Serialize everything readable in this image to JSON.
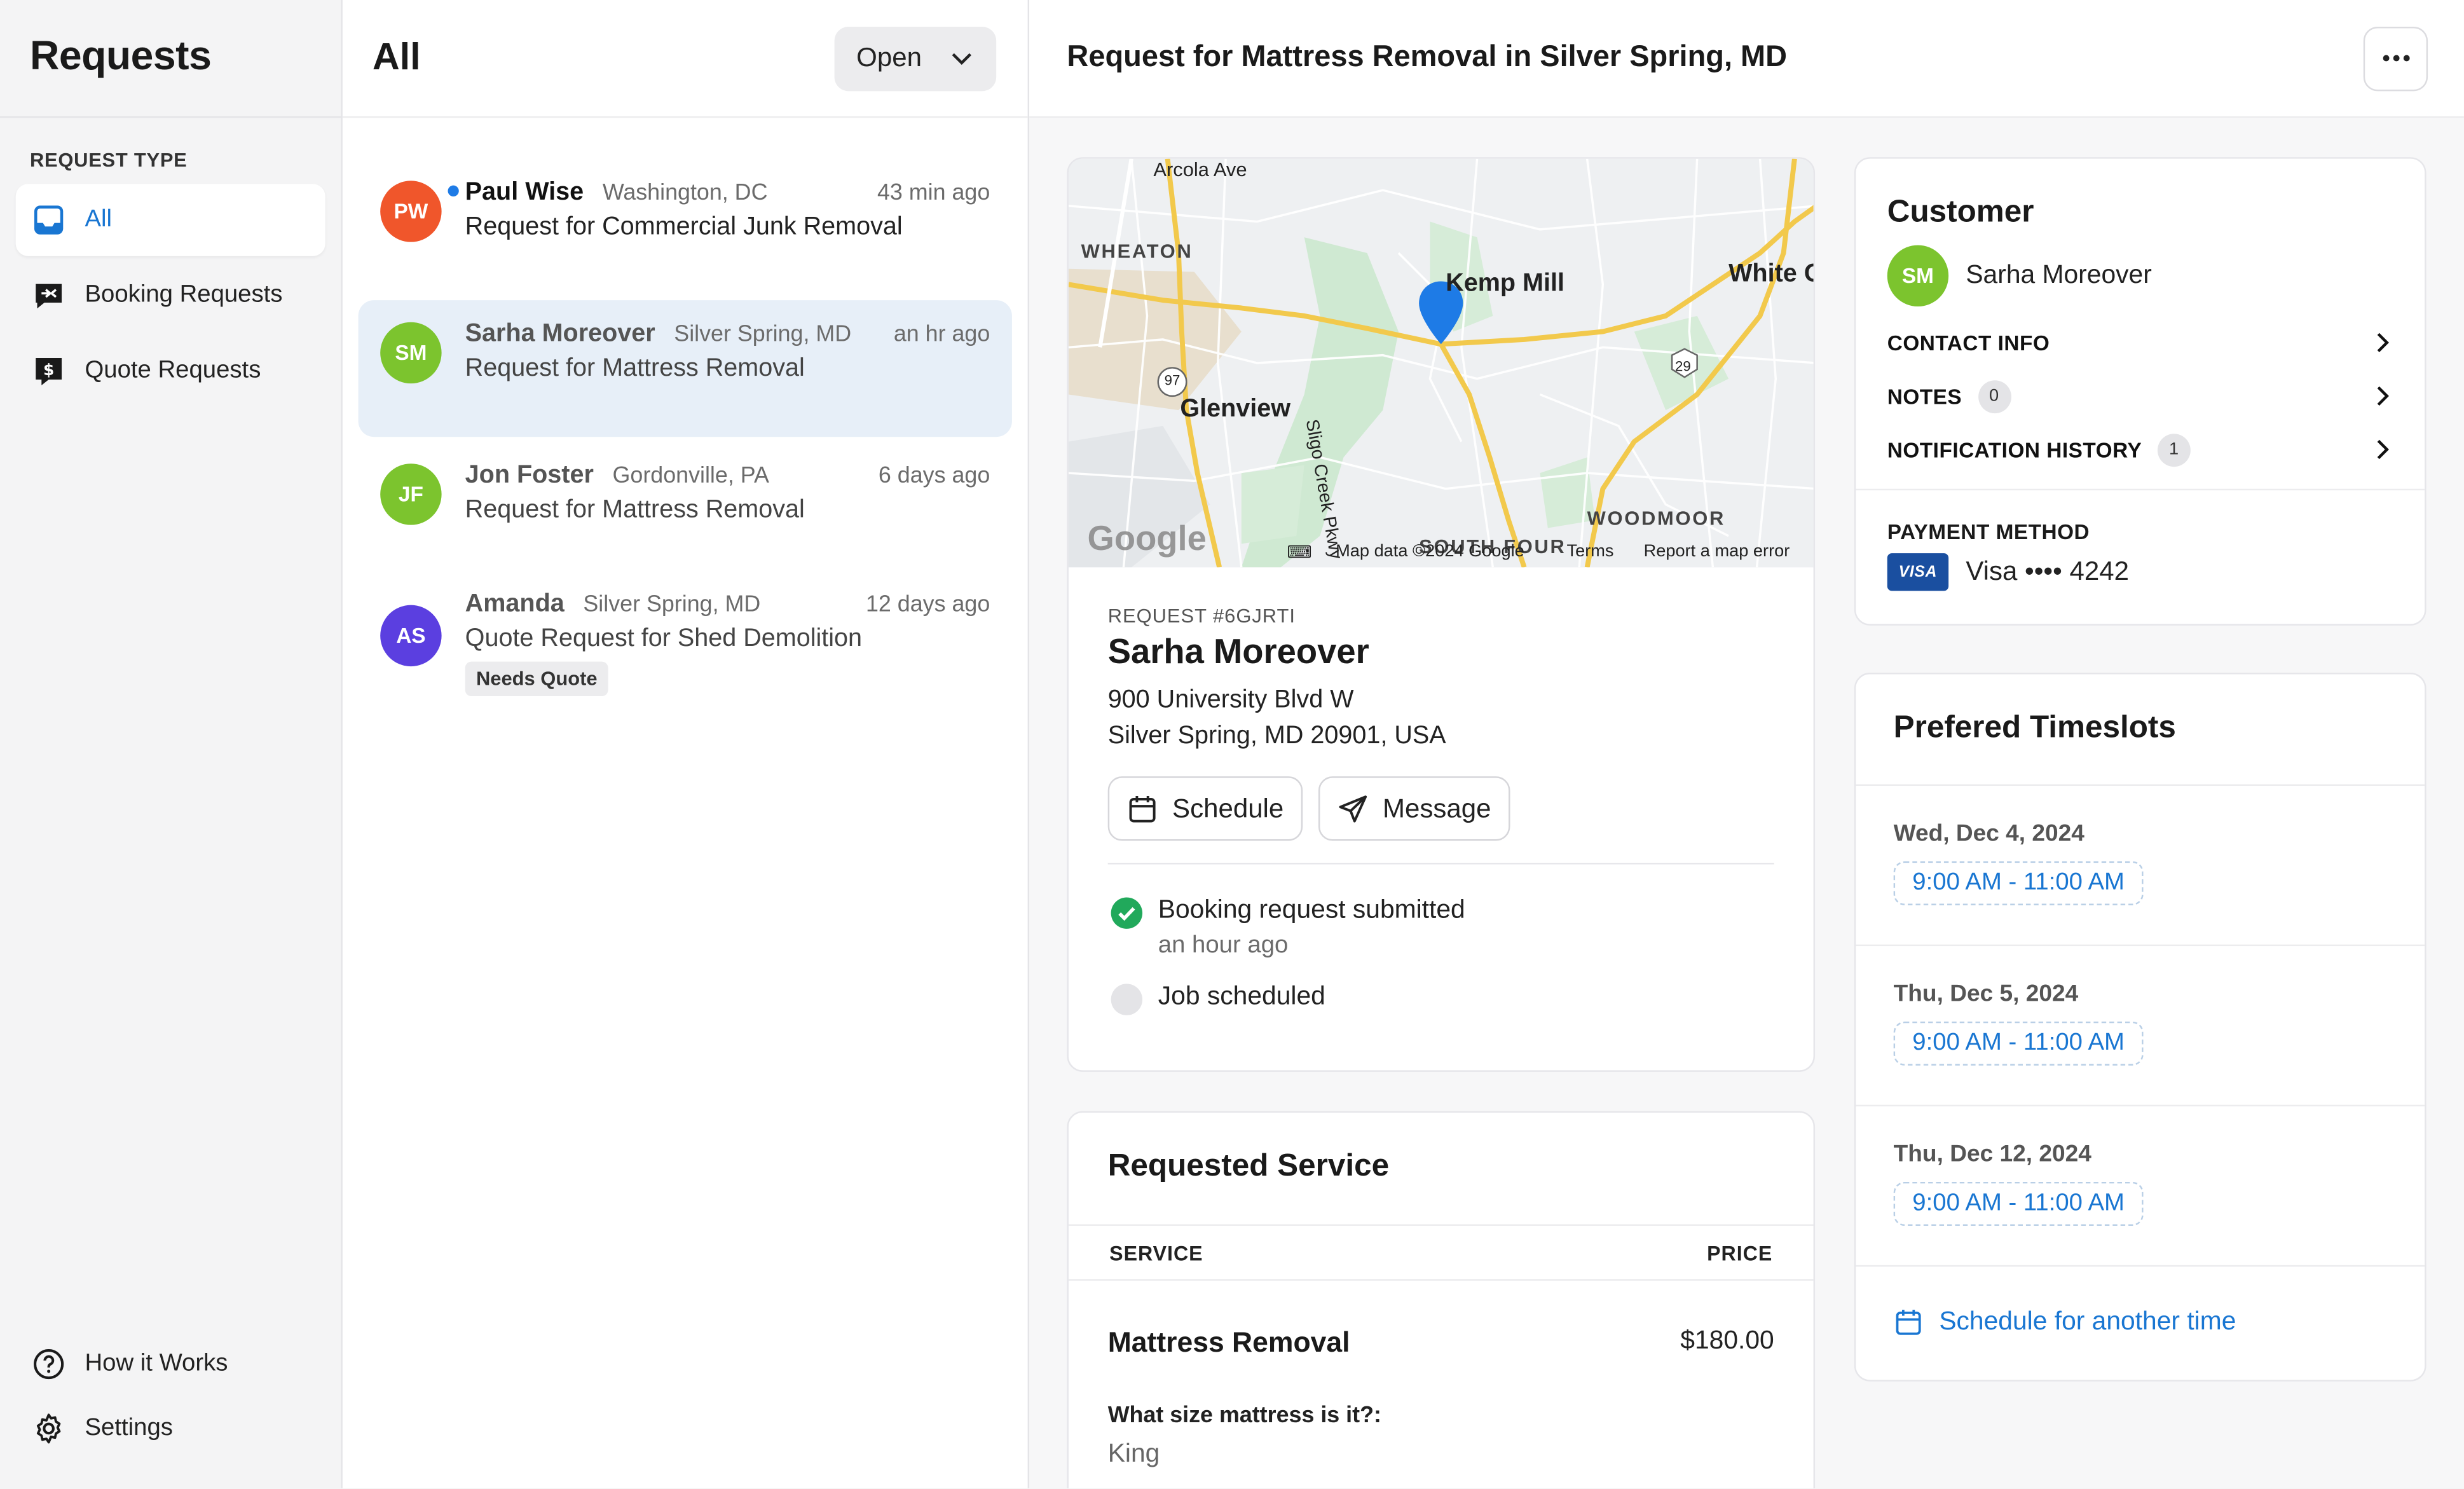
{
  "sidebar": {
    "title": "Requests",
    "section_label": "REQUEST TYPE",
    "items": [
      {
        "label": "All",
        "icon": "inbox-icon"
      },
      {
        "label": "Booking Requests",
        "icon": "booking-icon"
      },
      {
        "label": "Quote Requests",
        "icon": "quote-icon"
      }
    ],
    "bottom": [
      {
        "label": "How it Works",
        "icon": "help-circle-icon"
      },
      {
        "label": "Settings",
        "icon": "gear-icon"
      }
    ]
  },
  "list": {
    "title": "All",
    "filter_value": "Open",
    "requests": [
      {
        "initials": "PW",
        "name": "Paul Wise",
        "location": "Washington, DC",
        "time": "43 min ago",
        "description": "Request for Commercial Junk Removal",
        "color": "#f0562b",
        "unread": true
      },
      {
        "initials": "SM",
        "name": "Sarha Moreover",
        "location": "Silver Spring, MD",
        "time": "an hr ago",
        "description": "Request for Mattress Removal",
        "color": "#7cc42e",
        "unread": false
      },
      {
        "initials": "JF",
        "name": "Jon Foster",
        "location": "Gordonville, PA",
        "time": "6 days ago",
        "description": "Request for Mattress Removal",
        "color": "#7cc42e",
        "unread": false
      },
      {
        "initials": "AS",
        "name": "Amanda",
        "location": "Silver Spring, MD",
        "time": "12 days ago",
        "description": "Quote Request for Shed Demolition",
        "color": "#5b3fe0",
        "unread": false,
        "badge": "Needs Quote"
      }
    ]
  },
  "detail": {
    "title": "Request for Mattress Removal in Silver Spring, MD",
    "map": {
      "labels": {
        "arcola": "Arcola Ave",
        "wheaton": "WHEATON",
        "kemp": "Kemp Mill",
        "white": "White O",
        "glenview": "Glenview",
        "sligo": "Sligo Creek Pkwy",
        "woodmoor": "WOODMOOR",
        "south": "SOUTH FOUR",
        "r97": "97",
        "r29": "29"
      },
      "google": "Google",
      "map_data": "Map data ©2024 Google",
      "terms": "Terms",
      "report": "Report a map error"
    },
    "request_number": "REQUEST #6GJRTI",
    "customer_name": "Sarha Moreover",
    "address_line1": "900 University Blvd W",
    "address_line2": "Silver Spring, MD 20901, USA",
    "schedule_label": "Schedule",
    "message_label": "Message",
    "timeline": {
      "submitted": "Booking request submitted",
      "submitted_time": "an hour ago",
      "scheduled": "Job scheduled"
    },
    "service": {
      "title": "Requested Service",
      "col_service": "SERVICE",
      "col_price": "PRICE",
      "name": "Mattress Removal",
      "price": "$180.00",
      "question": "What size mattress is it?:",
      "answer": "King"
    }
  },
  "customer": {
    "title": "Customer",
    "initials": "SM",
    "name": "Sarha Moreover",
    "avatar_color": "#7cc42e",
    "contact_info": "CONTACT INFO",
    "notes": "NOTES",
    "notes_count": "0",
    "notification_history": "NOTIFICATION HISTORY",
    "notification_count": "1",
    "payment_label": "PAYMENT METHOD",
    "card_brand": "VISA",
    "card_text": "Visa •••• 4242"
  },
  "timeslots": {
    "title": "Prefered Timeslots",
    "slots": [
      {
        "date": "Wed, Dec 4, 2024",
        "time": "9:00 AM - 11:00 AM"
      },
      {
        "date": "Thu, Dec 5, 2024",
        "time": "9:00 AM - 11:00 AM"
      },
      {
        "date": "Thu, Dec 12, 2024",
        "time": "9:00 AM - 11:00 AM"
      }
    ],
    "another": "Schedule for another time"
  },
  "colors": {
    "accent": "#1976d2",
    "selected_bg": "#e7eff8",
    "success": "#21a95b"
  }
}
